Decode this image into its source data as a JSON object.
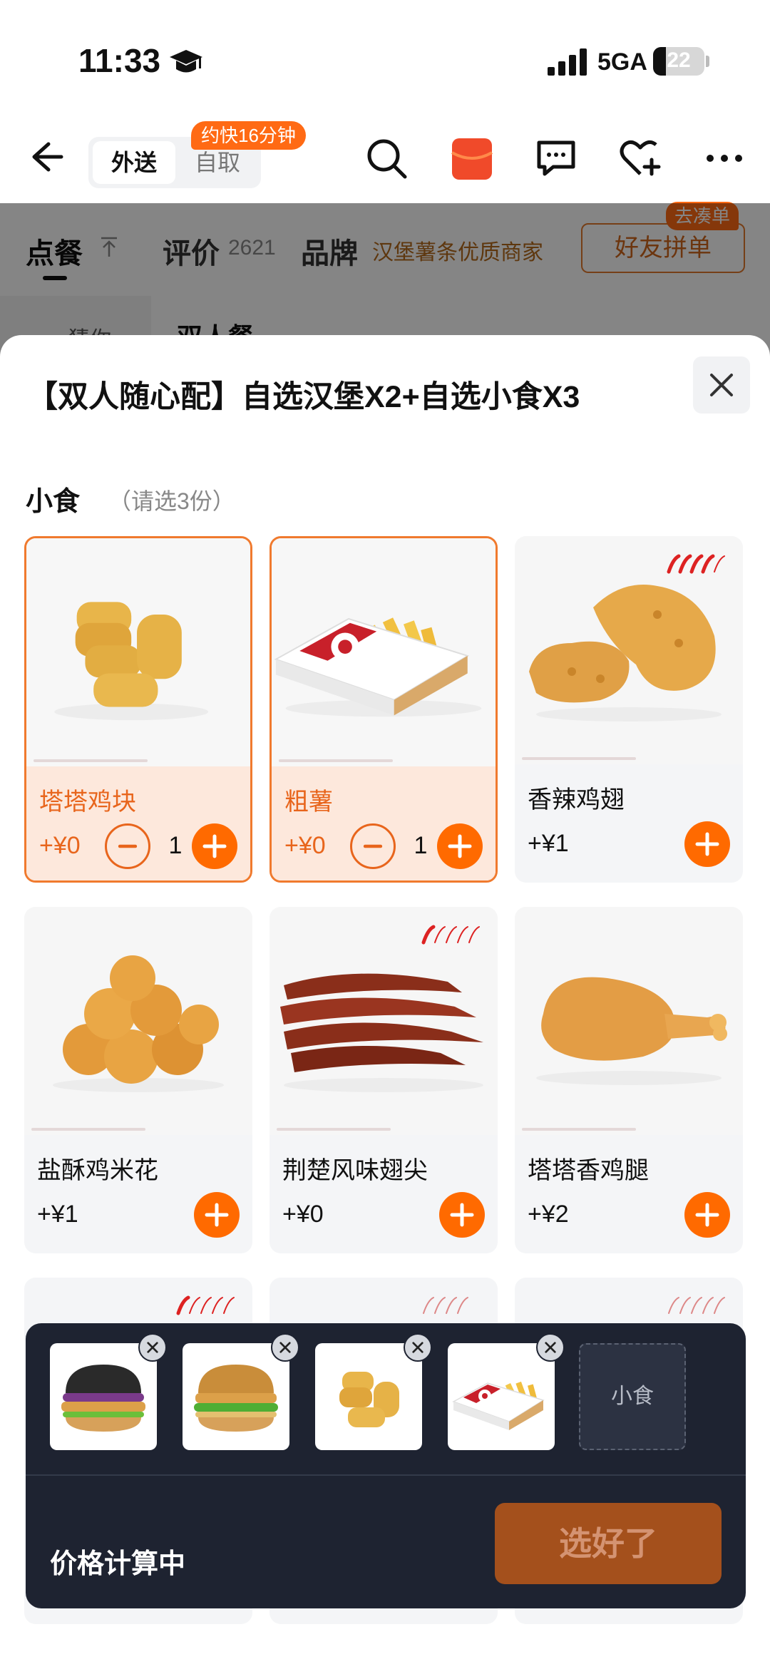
{
  "status_bar": {
    "time": "11:33",
    "network": "5GA",
    "battery": "22"
  },
  "nav": {
    "delivery_label": "外送",
    "pickup_label": "自取",
    "eta_badge": "约快16分钟"
  },
  "tabs": {
    "order_label": "点餐",
    "review_label": "评价",
    "review_count": "2621",
    "brand_label": "品牌",
    "brand_desc": "汉堡薯条优质商家",
    "group_button": "好友拼单",
    "group_badge": "去凑单"
  },
  "background": {
    "sidebar_item": "猜你",
    "section_title": "双人餐"
  },
  "sheet": {
    "title": "【双人随心配】自选汉堡X2+自选小食X3",
    "section_label": "小食",
    "section_hint": "（请选3份）",
    "items": [
      {
        "name": "塔塔鸡块",
        "price": "+¥0",
        "qty": "1",
        "selected": true,
        "spicy": 0
      },
      {
        "name": "粗薯",
        "price": "+¥0",
        "qty": "1",
        "selected": true,
        "spicy": 0
      },
      {
        "name": "香辣鸡翅",
        "price": "+¥1",
        "selected": false,
        "spicy": 4
      },
      {
        "name": "盐酥鸡米花",
        "price": "+¥1",
        "selected": false,
        "spicy": 0
      },
      {
        "name": "荆楚风味翅尖",
        "price": "+¥0",
        "selected": false,
        "spicy": 1
      },
      {
        "name": "塔塔香鸡腿",
        "price": "+¥2",
        "selected": false,
        "spicy": 0
      }
    ]
  },
  "bottom_bar": {
    "selected_thumbs": [
      "burger",
      "burger",
      "nuggets",
      "fries"
    ],
    "empty_slot_label": "小食",
    "price_status": "价格计算中",
    "done_button": "选好了"
  },
  "colors": {
    "accent": "#ff6a00",
    "selected_border": "#f07a2e",
    "selected_bg": "#fde8dc",
    "bar_bg": "#1e2331",
    "done_button": "#a4501c"
  }
}
